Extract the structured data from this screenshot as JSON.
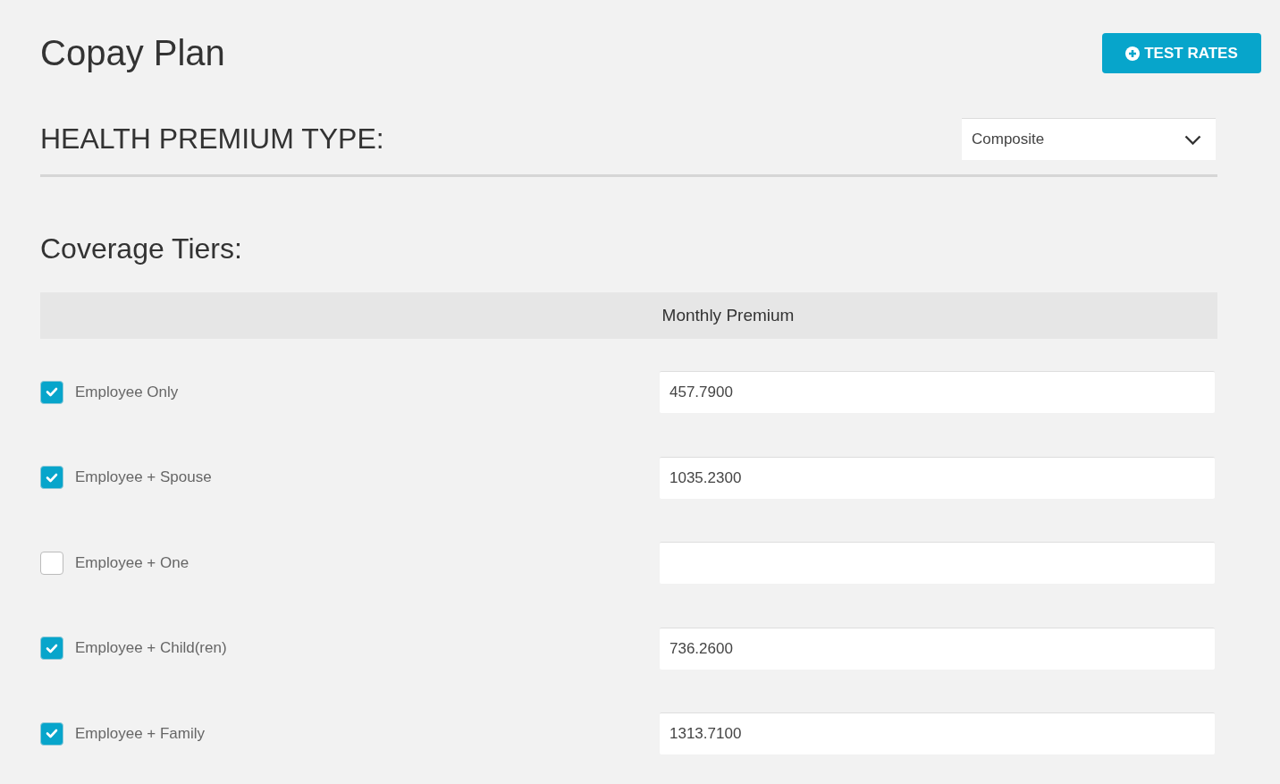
{
  "page_title": "Copay Plan",
  "test_rates_button": {
    "label": "TEST RATES"
  },
  "premium_type": {
    "label": "HEALTH PREMIUM TYPE:",
    "value": "Composite"
  },
  "coverage_heading": "Coverage Tiers:",
  "table": {
    "columns": [
      "Monthly Premium"
    ],
    "rows": [
      {
        "label": "Employee Only",
        "checked": true,
        "monthly_premium": "457.7900"
      },
      {
        "label": "Employee + Spouse",
        "checked": true,
        "monthly_premium": "1035.2300"
      },
      {
        "label": "Employee + One",
        "checked": false,
        "monthly_premium": ""
      },
      {
        "label": "Employee + Child(ren)",
        "checked": true,
        "monthly_premium": "736.2600"
      },
      {
        "label": "Employee + Family",
        "checked": true,
        "monthly_premium": "1313.7100"
      }
    ]
  }
}
